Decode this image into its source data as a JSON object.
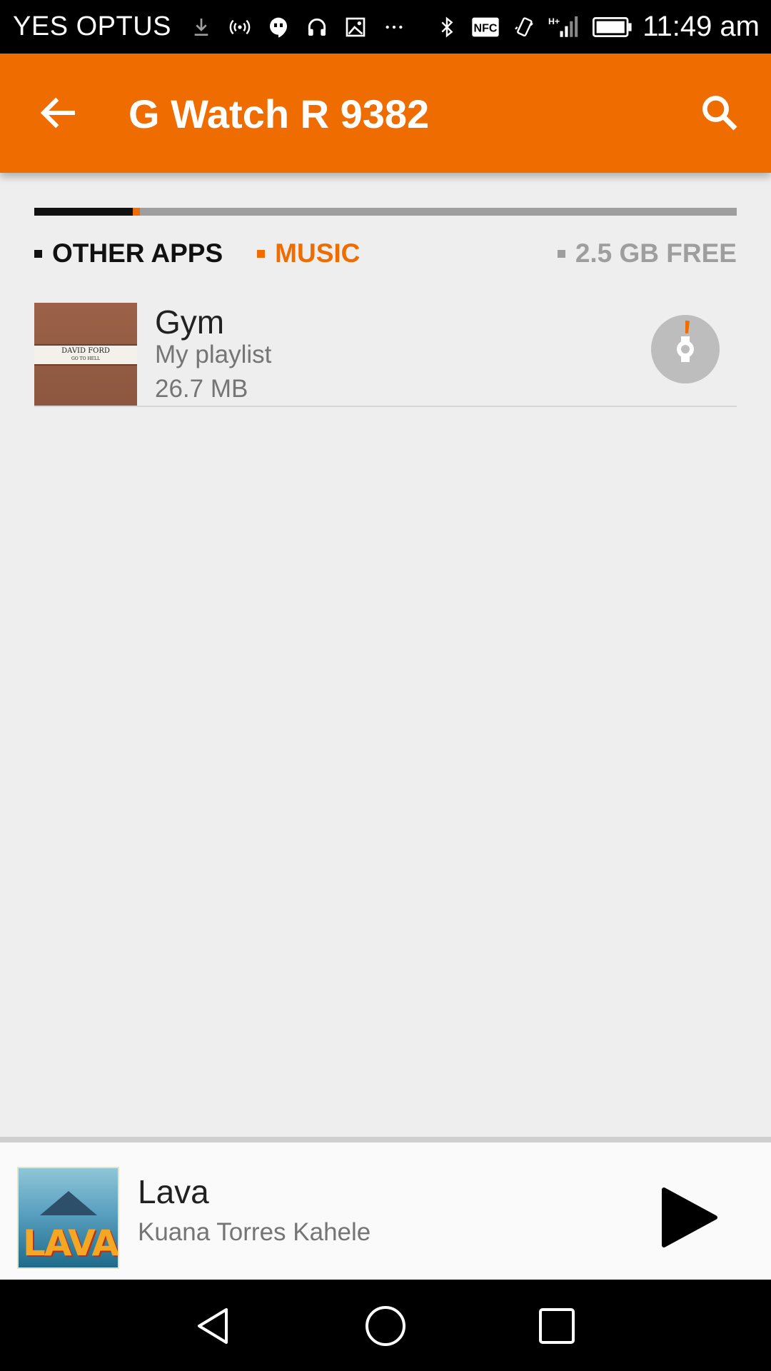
{
  "status_bar": {
    "carrier": "YES OPTUS",
    "time": "11:49 am",
    "icons_left": [
      "download-icon",
      "hotspot-icon",
      "hangouts-icon",
      "headphones-icon",
      "image-icon",
      "more-dots-icon"
    ],
    "icons_right": [
      "bluetooth-icon",
      "nfc-icon",
      "vibrate-icon",
      "signal-icon",
      "battery-icon"
    ],
    "nfc_label": "NFC",
    "network_label": "H+"
  },
  "app_bar": {
    "title": "G Watch R 9382",
    "background": "#ef6c00"
  },
  "storage": {
    "other_apps_fraction": 0.14,
    "music_fraction": 0.01,
    "legend_other": "OTHER APPS",
    "legend_music": "MUSIC",
    "legend_free": "2.5 GB FREE"
  },
  "playlists": [
    {
      "title": "Gym",
      "subtitle": "My playlist",
      "size": "26.7 MB",
      "art_text": "DAVID FORD",
      "art_sub": "GO TO HELL"
    }
  ],
  "now_playing": {
    "title": "Lava",
    "artist": "Kuana Torres Kahele",
    "art_text": "LAVA"
  },
  "colors": {
    "accent": "#ef6c00",
    "background": "#eeeeee",
    "free_space": "#9e9e9e"
  }
}
